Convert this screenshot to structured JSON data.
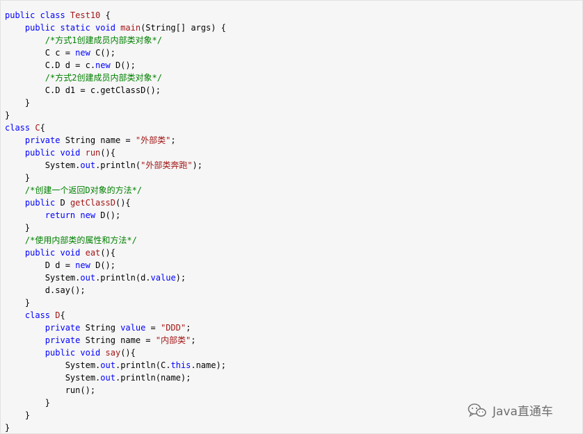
{
  "colors": {
    "keyword": "#0000ff",
    "method": "#a31515",
    "string": "#a31515",
    "comment": "#008000",
    "plain": "#000000",
    "field": "#0000ff"
  },
  "code_lines": [
    [
      [
        "public class ",
        "keyword"
      ],
      [
        "Test10",
        "method"
      ],
      [
        " {",
        "plain"
      ]
    ],
    [
      [
        "    public static void ",
        "keyword"
      ],
      [
        "main",
        "method"
      ],
      [
        "(String[] args) {",
        "plain"
      ]
    ],
    [
      [
        "        /*方式1创建成员内部类对象*/",
        "comment"
      ]
    ],
    [
      [
        "        C c = ",
        "plain"
      ],
      [
        "new",
        "keyword"
      ],
      [
        " C();",
        "plain"
      ]
    ],
    [
      [
        "        C.D d = c.",
        "plain"
      ],
      [
        "new",
        "keyword"
      ],
      [
        " D();",
        "plain"
      ]
    ],
    [
      [
        "        /*方式2创建成员内部类对象*/",
        "comment"
      ]
    ],
    [
      [
        "        C.D d1 = c.getClassD();",
        "plain"
      ]
    ],
    [
      [
        "    }",
        "plain"
      ]
    ],
    [
      [
        "}",
        "plain"
      ]
    ],
    [
      [
        "class ",
        "keyword"
      ],
      [
        "C",
        "method"
      ],
      [
        "{",
        "plain"
      ]
    ],
    [
      [
        "    private ",
        "keyword"
      ],
      [
        "String name = ",
        "plain"
      ],
      [
        "\"外部类\"",
        "string"
      ],
      [
        ";",
        "plain"
      ]
    ],
    [
      [
        "    public void ",
        "keyword"
      ],
      [
        "run",
        "method"
      ],
      [
        "(){",
        "plain"
      ]
    ],
    [
      [
        "        System.",
        "plain"
      ],
      [
        "out",
        "field"
      ],
      [
        ".println(",
        "plain"
      ],
      [
        "\"外部类奔跑\"",
        "string"
      ],
      [
        ");",
        "plain"
      ]
    ],
    [
      [
        "    }",
        "plain"
      ]
    ],
    [
      [
        "    /*创建一个返回D对象的方法*/",
        "comment"
      ]
    ],
    [
      [
        "    public ",
        "keyword"
      ],
      [
        "D ",
        "plain"
      ],
      [
        "getClassD",
        "method"
      ],
      [
        "(){",
        "plain"
      ]
    ],
    [
      [
        "        return new ",
        "keyword"
      ],
      [
        "D();",
        "plain"
      ]
    ],
    [
      [
        "    }",
        "plain"
      ]
    ],
    [
      [
        "    /*使用内部类的属性和方法*/",
        "comment"
      ]
    ],
    [
      [
        "    public void ",
        "keyword"
      ],
      [
        "eat",
        "method"
      ],
      [
        "(){",
        "plain"
      ]
    ],
    [
      [
        "        D d = ",
        "plain"
      ],
      [
        "new",
        "keyword"
      ],
      [
        " D();",
        "plain"
      ]
    ],
    [
      [
        "        System.",
        "plain"
      ],
      [
        "out",
        "field"
      ],
      [
        ".println(d.",
        "plain"
      ],
      [
        "value",
        "field"
      ],
      [
        ");",
        "plain"
      ]
    ],
    [
      [
        "        d.say();",
        "plain"
      ]
    ],
    [
      [
        "    }",
        "plain"
      ]
    ],
    [
      [
        "    class ",
        "keyword"
      ],
      [
        "D",
        "method"
      ],
      [
        "{",
        "plain"
      ]
    ],
    [
      [
        "        private ",
        "keyword"
      ],
      [
        "String ",
        "plain"
      ],
      [
        "value",
        "field"
      ],
      [
        " = ",
        "plain"
      ],
      [
        "\"DDD\"",
        "string"
      ],
      [
        ";",
        "plain"
      ]
    ],
    [
      [
        "        private ",
        "keyword"
      ],
      [
        "String name = ",
        "plain"
      ],
      [
        "\"内部类\"",
        "string"
      ],
      [
        ";",
        "plain"
      ]
    ],
    [
      [
        "        public void ",
        "keyword"
      ],
      [
        "say",
        "method"
      ],
      [
        "(){",
        "plain"
      ]
    ],
    [
      [
        "            System.",
        "plain"
      ],
      [
        "out",
        "field"
      ],
      [
        ".println(C.",
        "plain"
      ],
      [
        "this",
        "keyword"
      ],
      [
        ".name);",
        "plain"
      ]
    ],
    [
      [
        "            System.",
        "plain"
      ],
      [
        "out",
        "field"
      ],
      [
        ".println(name);",
        "plain"
      ]
    ],
    [
      [
        "            run();",
        "plain"
      ]
    ],
    [
      [
        "        }",
        "plain"
      ]
    ],
    [
      [
        "    }",
        "plain"
      ]
    ],
    [
      [
        "}",
        "plain"
      ]
    ]
  ],
  "watermark": {
    "icon": "wechat-icon",
    "text": "Java直通车"
  }
}
